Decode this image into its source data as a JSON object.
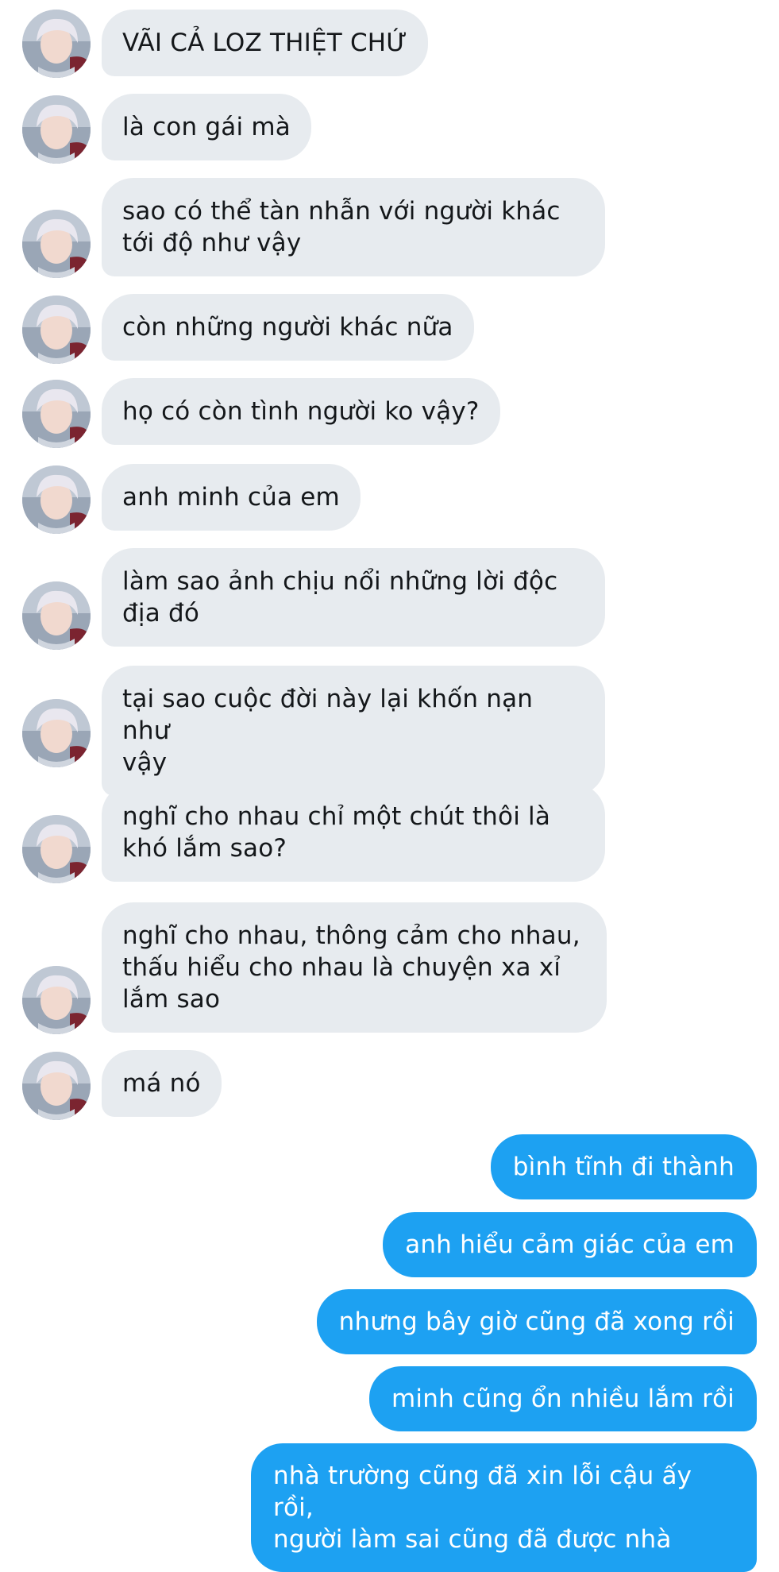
{
  "colors": {
    "incoming_bubble": "#e7ebef",
    "outgoing_bubble": "#1da1f2",
    "incoming_text": "#14171a",
    "outgoing_text": "#ffffff"
  },
  "avatar_icon": "user-avatar-photo",
  "incoming": [
    "VÃI CẢ LOZ THIỆT CHỨ",
    "là con gái mà",
    "sao có thể tàn nhẫn với người khác\ntới độ như vậy",
    "còn những người khác nữa",
    "họ có còn tình người ko vậy?",
    "anh minh của em",
    "làm sao ảnh chịu nổi những lời độc\nđịa đó",
    "tại sao cuộc đời này lại khốn nạn như\nvậy",
    "nghĩ cho nhau chỉ một chút thôi là\nkhó lắm sao?",
    "nghĩ cho nhau, thông cảm cho nhau,\nthấu hiểu cho nhau là chuyện xa xỉ\nlắm sao",
    "má nó"
  ],
  "outgoing": [
    "bình tĩnh đi thành",
    "anh hiểu cảm giác của em",
    "nhưng bây giờ cũng đã xong rồi",
    "minh cũng ổn nhiều lắm rồi",
    "nhà trường cũng đã xin lỗi cậu ấy rồi,\nngười làm sai cũng đã được nhà"
  ]
}
